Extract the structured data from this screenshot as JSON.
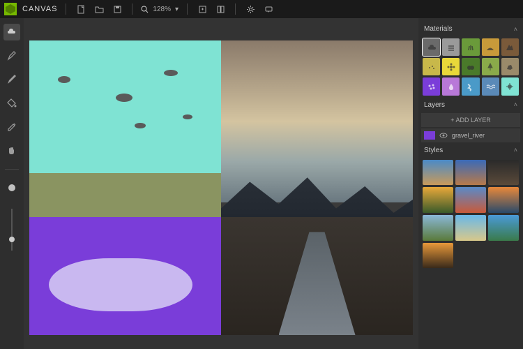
{
  "app": {
    "title": "CANVAS"
  },
  "titlebar": {
    "zoom_value": "128%"
  },
  "panels": {
    "materials": {
      "title": "Materials"
    },
    "layers": {
      "title": "Layers",
      "add_button": "+ ADD LAYER",
      "items": [
        {
          "name": "gravel_river",
          "color": "#7a3dd9"
        }
      ]
    },
    "styles": {
      "title": "Styles"
    }
  },
  "materials": [
    {
      "name": "cloud",
      "color": "#6a6a6a",
      "selected": true
    },
    {
      "name": "fog",
      "color": "#9a9a9a"
    },
    {
      "name": "grass",
      "color": "#6a9a3a"
    },
    {
      "name": "hill",
      "color": "#c89a3a"
    },
    {
      "name": "mountain",
      "color": "#7a5a3a"
    },
    {
      "name": "dirt",
      "color": "#c8b84a"
    },
    {
      "name": "flower",
      "color": "#e8d83a"
    },
    {
      "name": "bush",
      "color": "#4a7a2a"
    },
    {
      "name": "tree",
      "color": "#8aaa4a"
    },
    {
      "name": "rock",
      "color": "#9a8a6a"
    },
    {
      "name": "gravel",
      "color": "#7a3dd9"
    },
    {
      "name": "water",
      "color": "#b878d8"
    },
    {
      "name": "river",
      "color": "#4a9ac8"
    },
    {
      "name": "sea",
      "color": "#5a8ab8"
    },
    {
      "name": "sky",
      "color": "#7fe3d3"
    }
  ],
  "styles": [
    {
      "name": "desert-arch",
      "bg": "linear-gradient(180deg,#4a8ac8,#c89a5a)"
    },
    {
      "name": "canyon",
      "bg": "linear-gradient(180deg,#3a6ab8,#b87a4a)"
    },
    {
      "name": "cave",
      "bg": "linear-gradient(180deg,#2a2a2a,#5a4a3a)"
    },
    {
      "name": "sunset-field",
      "bg": "linear-gradient(180deg,#e8a83a,#3a5a2a)"
    },
    {
      "name": "red-rock",
      "bg": "linear-gradient(180deg,#5a8ac8,#c85a3a)"
    },
    {
      "name": "ocean-sunset",
      "bg": "linear-gradient(180deg,#e8883a,#2a4a6a)"
    },
    {
      "name": "valley",
      "bg": "linear-gradient(180deg,#8ab8d8,#5a7a3a)"
    },
    {
      "name": "beach",
      "bg": "linear-gradient(180deg,#6ab8e8,#d8c88a)"
    },
    {
      "name": "alpine-lake",
      "bg": "linear-gradient(180deg,#4a9ad8,#3a7a4a)"
    },
    {
      "name": "golden-hour",
      "bg": "linear-gradient(180deg,#e8983a,#3a2a1a)"
    }
  ]
}
